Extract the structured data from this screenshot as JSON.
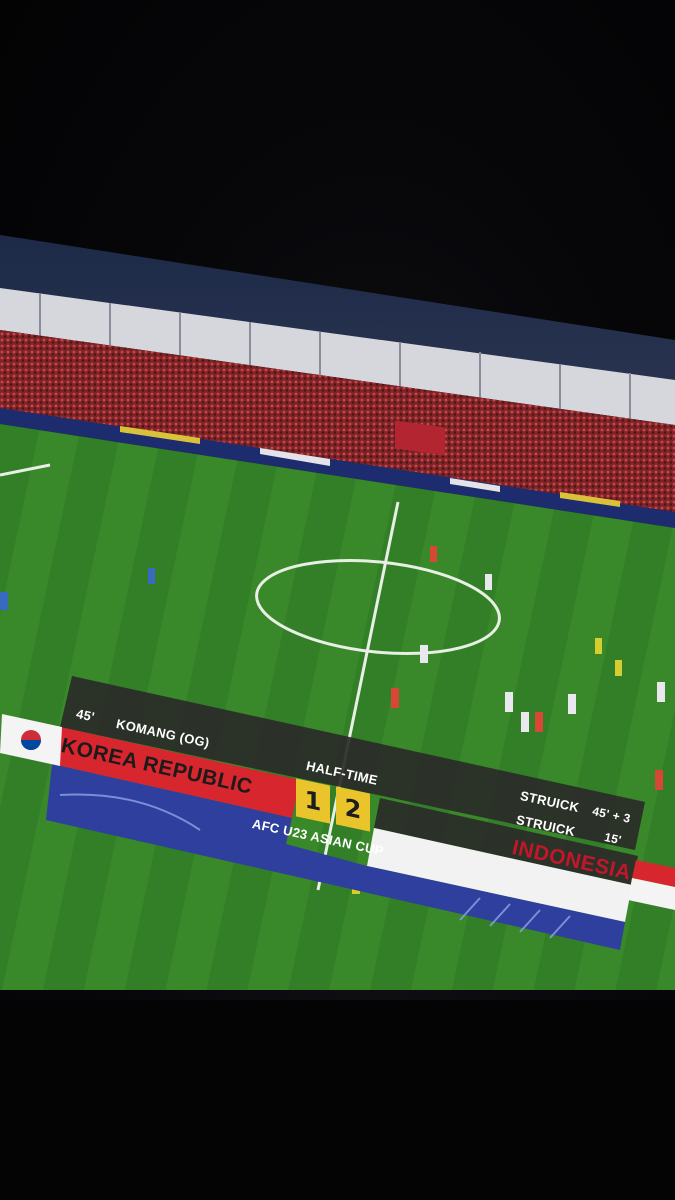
{
  "scoreboard": {
    "minute": "45'",
    "home_scorer": "KOMANG (OG)",
    "home_team": "KOREA REPUBLIC",
    "status": "HALF-TIME",
    "home_score": "1",
    "away_score": "2",
    "away_team": "INDONESIA",
    "competition": "AFC U23 ASIAN CUP",
    "away_scorers": [
      {
        "name": "STRUICK",
        "minute": "45' + 3"
      },
      {
        "name": "STRUICK",
        "minute": "15'"
      }
    ]
  },
  "colors": {
    "pitch": "#3f8a2e",
    "crowd": "#8a2a2a",
    "home_band": "#d8262e",
    "competition_band": "#2e3f9e",
    "score_box": "#e9c52b",
    "away_text": "#c4162a"
  }
}
